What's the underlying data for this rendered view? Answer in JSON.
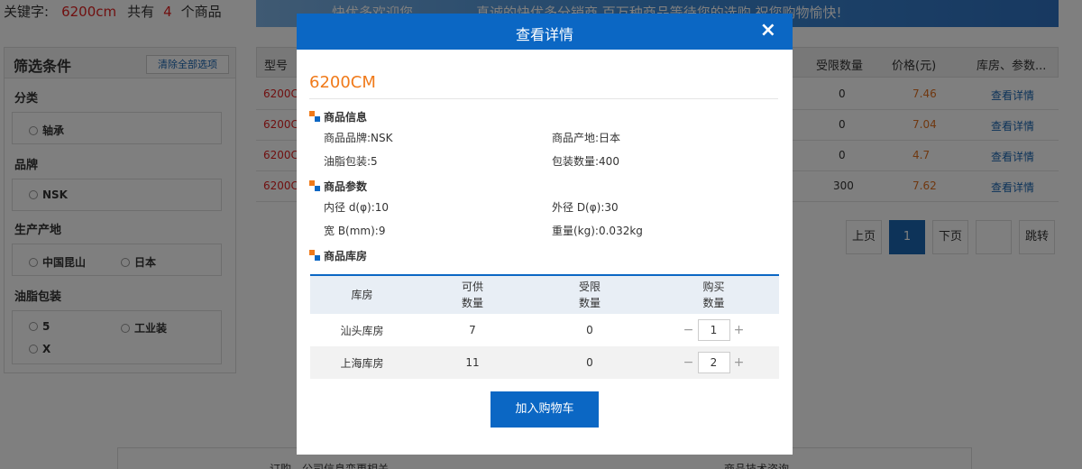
{
  "search": {
    "label": "关键字:",
    "keyword": "6200cm",
    "total_prefix": "共有",
    "count": "4",
    "total_suffix": "个商品"
  },
  "banner": {
    "left_text": "快优多欢迎您",
    "right_text": "真诚的快优多分销商,百万种商品等待您的选购,祝您购物愉快!"
  },
  "filter": {
    "title": "筛选条件",
    "clear_label": "清除全部选项",
    "groups": [
      {
        "title": "分类",
        "options": [
          "轴承"
        ]
      },
      {
        "title": "品牌",
        "options": [
          "NSK"
        ]
      },
      {
        "title": "生产产地",
        "options": [
          "中国昆山",
          "日本"
        ]
      },
      {
        "title": "油脂包装",
        "options": [
          "5",
          "工业装",
          "X"
        ]
      }
    ]
  },
  "results": {
    "headers": [
      "型号",
      "受限数量",
      "价格(元)",
      "库房、参数..."
    ],
    "rows": [
      {
        "model": "6200C",
        "limit": "0",
        "price": "7.46",
        "detail": "查看详情"
      },
      {
        "model": "6200C",
        "limit": "0",
        "price": "7.04",
        "detail": "查看详情"
      },
      {
        "model": "6200C",
        "limit": "0",
        "price": "4.7",
        "detail": "查看详情"
      },
      {
        "model": "6200C",
        "limit": "300",
        "price": "7.62",
        "detail": "查看详情"
      }
    ],
    "pager": {
      "prev": "上页",
      "current": "1",
      "next": "下页",
      "jump": "跳转"
    }
  },
  "footer": {
    "left": "订购、公司信息变更相关",
    "right": "商品技术咨询"
  },
  "modal": {
    "title": "查看详情",
    "close_icon": "×",
    "product_name": "6200CM",
    "sections": {
      "info_title": "商品信息",
      "params_title": "商品参数",
      "stock_title": "商品库房"
    },
    "info": {
      "brand_label": "商品品牌:",
      "brand": "NSK",
      "origin_label": "商品产地:",
      "origin": "日本",
      "grease_label": "油脂包装:",
      "grease": "5",
      "pack_label": "包装数量:",
      "pack": "400"
    },
    "params": {
      "inner_label": "内径 d(φ):",
      "inner": "10",
      "outer_label": "外径 D(φ):",
      "outer": "30",
      "width_label": "宽 B(mm):",
      "width": "9",
      "weight_label": "重量(kg):",
      "weight": "0.032kg"
    },
    "stock_table": {
      "headers": [
        "库房",
        "可供\n数量",
        "受限\n数量",
        "购买\n数量"
      ],
      "rows": [
        {
          "warehouse": "汕头库房",
          "available": "7",
          "limited": "0",
          "qty": "1"
        },
        {
          "warehouse": "上海库房",
          "available": "11",
          "limited": "0",
          "qty": "2"
        }
      ],
      "minus": "−",
      "plus": "+"
    },
    "add_to_cart": "加入购物车"
  },
  "colors": {
    "primary": "#0b67c4",
    "accent": "#f07a1a",
    "price": "#e07020",
    "link": "#1a66b3"
  }
}
